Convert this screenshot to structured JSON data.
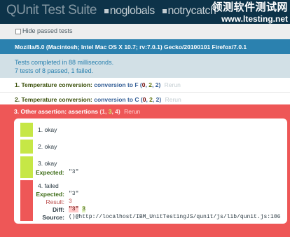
{
  "header": {
    "title": "QUnit Test Suite",
    "options": [
      "noglobals",
      "notrycatch"
    ],
    "watermark_line1": "领测软件测试网",
    "watermark_line2": "www.ltesting.net"
  },
  "toolbar": {
    "hide_passed_label": "Hide passed tests"
  },
  "user_agent": "Mozilla/5.0 (Macintosh; Intel Mac OS X 10.7; rv:7.0.1) Gecko/20100101 Firefox/7.0.1",
  "summary": {
    "line1": "Tests completed in 88 milliseconds.",
    "line2": "7 tests of 8 passed, 1 failed."
  },
  "tests": [
    {
      "num": "1.",
      "module": "Temperature conversion:",
      "name": "conversion to F",
      "open": "(",
      "failed": "0",
      "passed": "2",
      "total": "2",
      "close": ")",
      "rerun": "Rerun"
    },
    {
      "num": "2.",
      "module": "Temperature conversion:",
      "name": "conversion to C",
      "open": "(",
      "failed": "0",
      "passed": "2",
      "total": "2",
      "close": ")",
      "rerun": "Rerun"
    }
  ],
  "failed_test": {
    "num": "3.",
    "name": "Other assertion: assertions",
    "open": "(",
    "failed": "1",
    "passed": "3",
    "total": "4",
    "close": ")",
    "rerun": "Rerun",
    "assertions": {
      "a1": "okay",
      "a2": "okay",
      "a3": "okay",
      "a3_expected_label": "Expected:",
      "a3_expected_value": "\"3\"",
      "a4": "failed",
      "a4_expected_label": "Expected:",
      "a4_expected_value": "\"3\"",
      "a4_result_label": "Result:",
      "a4_result_value": "3",
      "a4_diff_label": "Diff:",
      "a4_diff_del": "\"3\"",
      "a4_diff_ins": "3",
      "a4_source_label": "Source:",
      "a4_source_value": "()@http://localhost/IBM_UnitTestingJS/qunit/js/lib/qunit.js:106"
    }
  },
  "colors": {
    "header_bg": "#0d3349",
    "user_agent_bg": "#2b81af",
    "result_bg": "#d2e0e6",
    "fail_bg": "#ee5757",
    "pass_bar": "#c6e746"
  }
}
